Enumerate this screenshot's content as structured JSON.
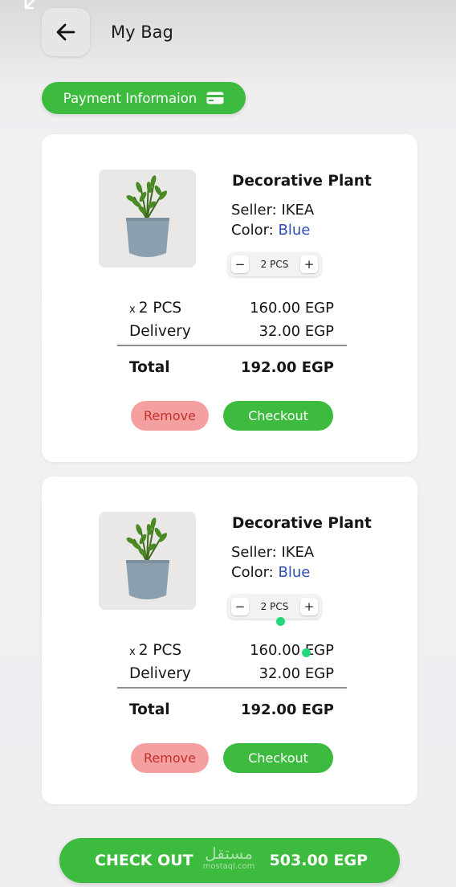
{
  "header": {
    "title": "My Bag",
    "back_icon": "arrow-left-icon"
  },
  "payment_pill": {
    "label": "Payment Informaion",
    "icon": "credit-card-icon"
  },
  "cart_items": [
    {
      "name": "Decorative Plant",
      "seller": "Seller: IKEA",
      "color_label": "Color: ",
      "color_value": "Blue",
      "stepper_minus": "−",
      "stepper_qty": "2 PCS",
      "stepper_plus": "+",
      "qty_mark": "x",
      "qty_line": "2 PCS",
      "price": "160.00 EGP",
      "delivery_label": "Delivery",
      "delivery_price": "32.00 EGP",
      "total_label": "Total",
      "total": "192.00 EGP",
      "remove_label": "Remove",
      "checkout_label": "Checkout"
    },
    {
      "name": "Decorative Plant",
      "seller": "Seller: IKEA",
      "color_label": "Color: ",
      "color_value": "Blue",
      "stepper_minus": "−",
      "stepper_qty": "2 PCS",
      "stepper_plus": "+",
      "qty_mark": "x",
      "qty_line": "2 PCS",
      "price": "160.00 EGP",
      "delivery_label": "Delivery",
      "delivery_price": "32.00 EGP",
      "total_label": "Total",
      "total": "192.00 EGP",
      "remove_label": "Remove",
      "checkout_label": "Checkout"
    }
  ],
  "bottom_bar": {
    "label": "CHECK OUT",
    "total": "503.00 EGP",
    "watermark_ar": "مستقل",
    "watermark_en": "mostaql.com"
  },
  "colors": {
    "accent_green": "#3dbb3f",
    "remove_bg": "#f5a0a0",
    "remove_text": "#c3322f",
    "color_blue": "#2f4fb8"
  }
}
